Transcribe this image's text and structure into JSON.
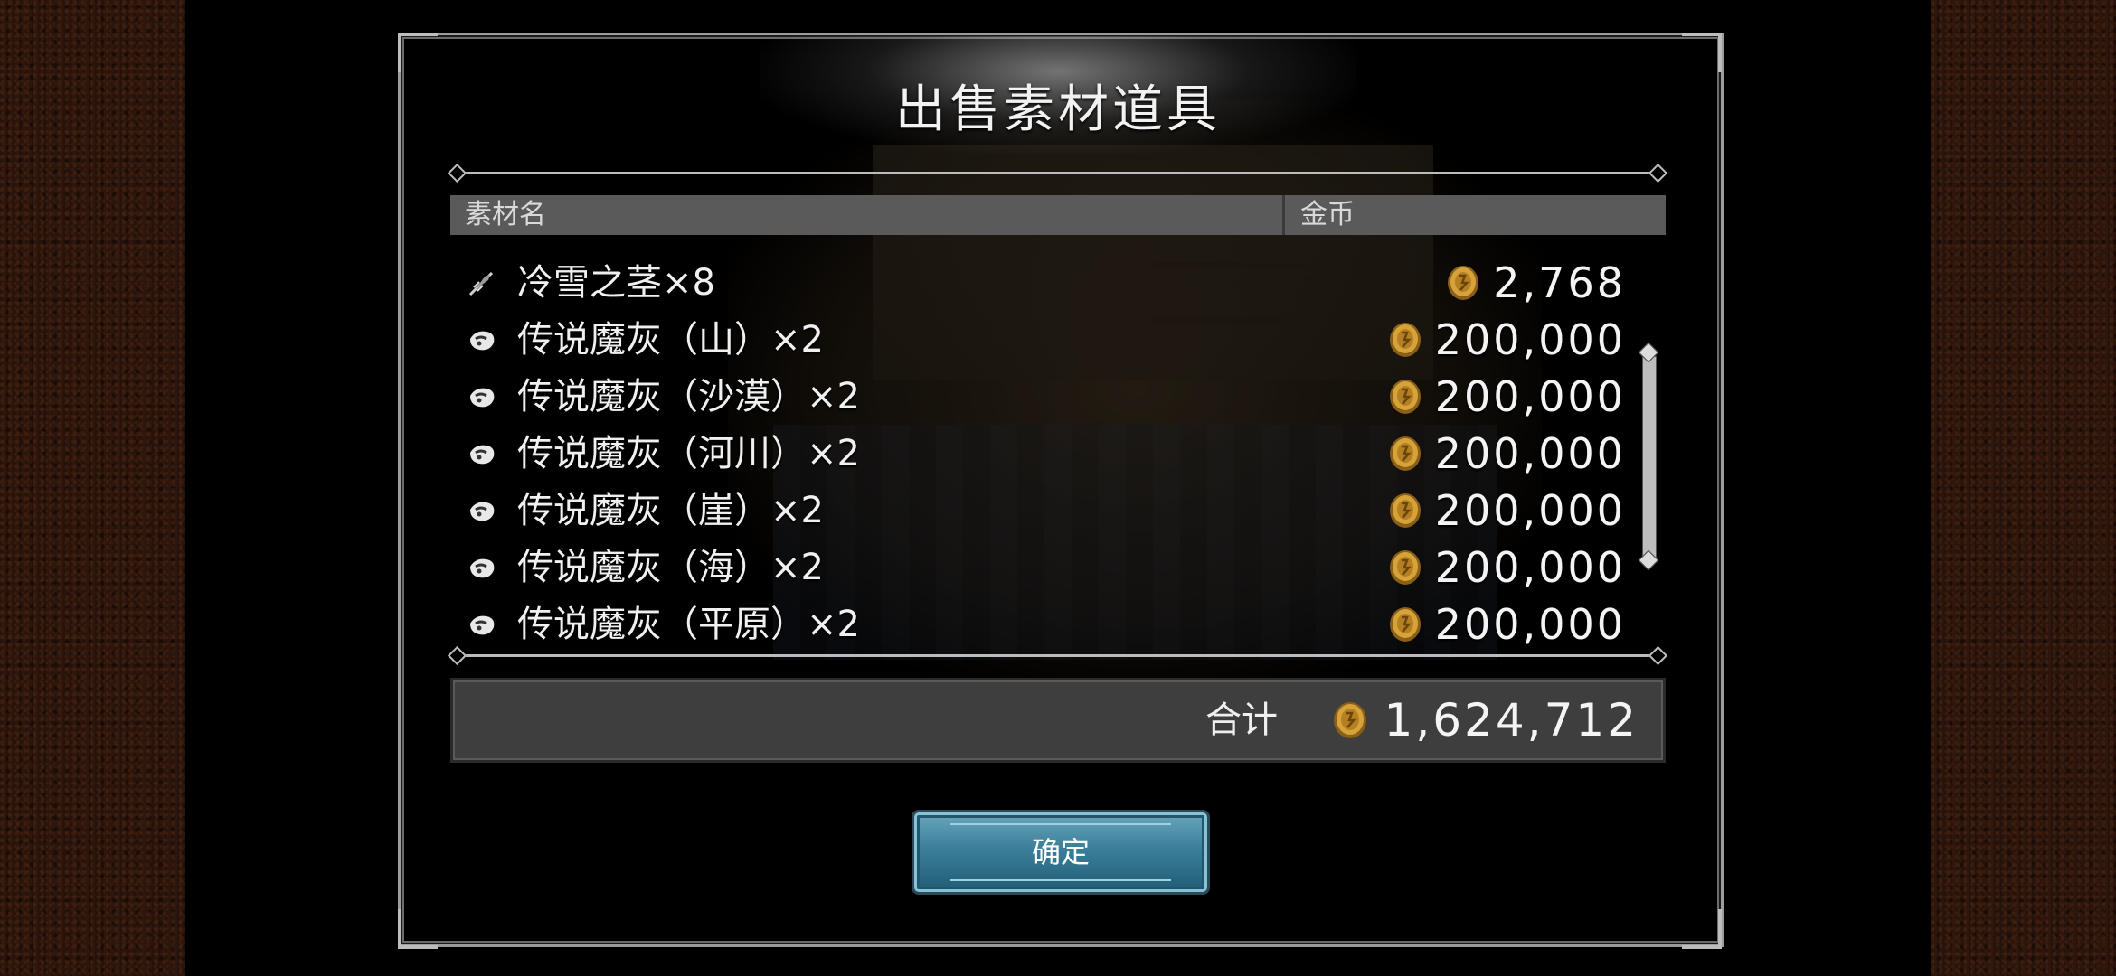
{
  "dialog": {
    "title": "出售素材道具",
    "header": {
      "name_col": "素材名",
      "coin_col": "金币"
    },
    "items": [
      {
        "icon": "feather-icon",
        "name": "冷雪之茎×8",
        "price": "2,768"
      },
      {
        "icon": "ash-icon",
        "name": "传说魔灰（山）×2",
        "price": "200,000"
      },
      {
        "icon": "ash-icon",
        "name": "传说魔灰（沙漠）×2",
        "price": "200,000"
      },
      {
        "icon": "ash-icon",
        "name": "传说魔灰（河川）×2",
        "price": "200,000"
      },
      {
        "icon": "ash-icon",
        "name": "传说魔灰（崖）×2",
        "price": "200,000"
      },
      {
        "icon": "ash-icon",
        "name": "传说魔灰（海）×2",
        "price": "200,000"
      },
      {
        "icon": "ash-icon",
        "name": "传说魔灰（平原）×2",
        "price": "200,000"
      }
    ],
    "total": {
      "label": "合计",
      "value": "1,624,712"
    },
    "confirm_label": "确定"
  },
  "colors": {
    "coin": "#c9962f",
    "button": "#3c7f9a",
    "header": "#5a5a5a"
  }
}
